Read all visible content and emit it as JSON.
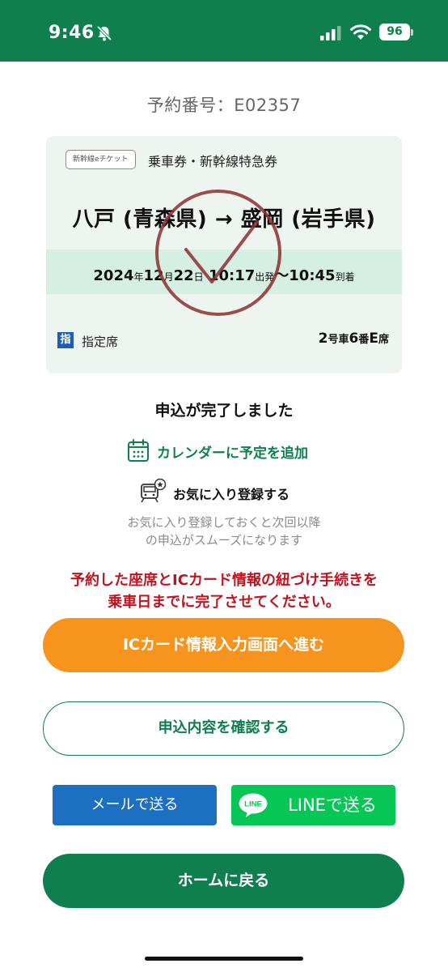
{
  "status_bar": {
    "time": "9:46",
    "battery": "96"
  },
  "reservation": {
    "number_label": "予約番号：E02357"
  },
  "ticket": {
    "badge": "新幹線eチケット",
    "type": "乗車券・新幹線特急券",
    "route": "八戸 (青森県) → 盛岡 (岩手県)",
    "date": {
      "year": "2024",
      "year_unit": "年",
      "month": "12",
      "month_unit": "月",
      "day": "22",
      "day_unit": "日",
      "depart_time": "10:17",
      "depart_label": "出発",
      "separator": "〜",
      "arrive_time": "10:45",
      "arrive_label": "到着"
    },
    "seat_icon": "指",
    "seat_class": "指定席",
    "seat": {
      "car": "2",
      "car_unit": "号車",
      "row": "6",
      "row_unit": "番",
      "seat": "E",
      "seat_unit": "席"
    }
  },
  "completion": {
    "title": "申込が完了しました"
  },
  "calendar": {
    "label": "カレンダーに予定を追加",
    "icon": "calendar-icon"
  },
  "favorite": {
    "label": "お気に入り登録する",
    "icon": "train-favorite-icon",
    "note_line1": "お気に入り登録しておくと次回以降",
    "note_line2": "の申込がスムーズになります"
  },
  "warning": {
    "line1": "予約した座席とICカード情報の紐づけ手続きを",
    "line2": "乗車日までに完了させてください。"
  },
  "buttons": {
    "ic_card": "ICカード情報入力画面へ進む",
    "confirm": "申込内容を確認する",
    "mail": "メールで送る",
    "line": "LINEで送る",
    "line_logo": "LINE",
    "home": "ホームに戻る"
  },
  "colors": {
    "brand_green": "#0f7f4f",
    "orange": "#f7941d",
    "warning_red": "#c1121f",
    "mail_blue": "#1d6fc1",
    "line_green": "#06c755",
    "stamp": "#8c2f2f"
  }
}
